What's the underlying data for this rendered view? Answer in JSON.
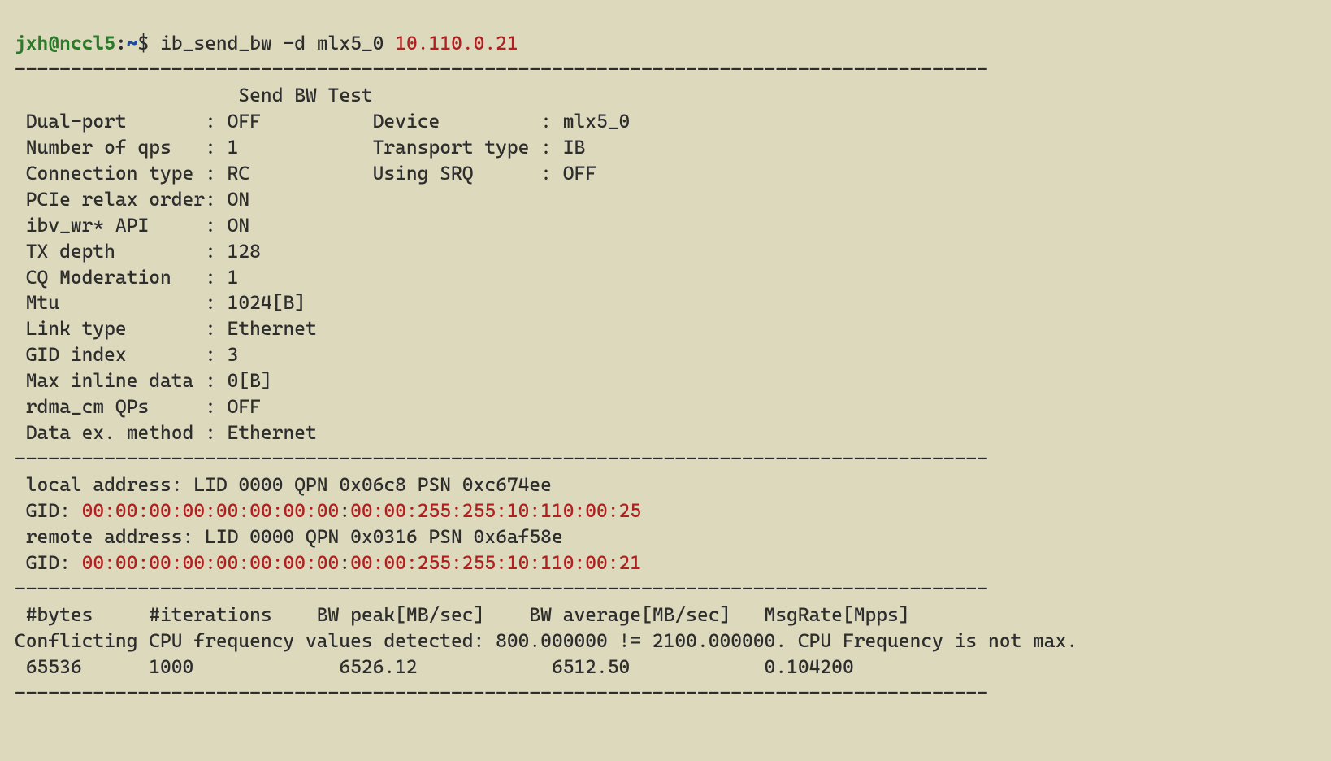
{
  "prompt": {
    "user": "jxh",
    "at": "@",
    "host": "nccl5",
    "colon": ":",
    "path": "~",
    "dollar": "$ ",
    "cmd": "ib_send_bw -d mlx5_0 ",
    "target": "10.110.0.21"
  },
  "dashes": "---------------------------------------------------------------------------------------",
  "title": "                    Send BW Test",
  "props": {
    "l01": " Dual-port       : OFF\t\tDevice         : mlx5_0",
    "l02": " Number of qps   : 1\t\tTransport type : IB",
    "l03": " Connection type : RC\t\tUsing SRQ      : OFF",
    "l04": " PCIe relax order: ON",
    "l05": " ibv_wr* API     : ON",
    "l06": " TX depth        : 128",
    "l07": " CQ Moderation   : 1",
    "l08": " Mtu             : 1024[B]",
    "l09": " Link type       : Ethernet",
    "l10": " GID index       : 3",
    "l11": " Max inline data : 0[B]",
    "l12": " rdma_cm QPs\t : OFF",
    "l13": " Data ex. method : Ethernet"
  },
  "addr": {
    "local": " local address: LID 0000 QPN 0x06c8 PSN 0xc674ee",
    "gid1_label": " GID: ",
    "gid1_a": "00:00:00:00:00:00:00:00",
    "gid1_sep": ":",
    "gid1_b": "00:00:255:255:10:110:00:25",
    "remote": " remote address: LID 0000 QPN 0x0316 PSN 0x6af58e",
    "gid2_label": " GID: ",
    "gid2_a": "00:00:00:00:00:00:00:00",
    "gid2_sep": ":",
    "gid2_b": "00:00:255:255:10:110:00:21"
  },
  "table": {
    "header": " #bytes     #iterations    BW peak[MB/sec]    BW average[MB/sec]   MsgRate[Mpps]",
    "warn": "Conflicting CPU frequency values detected: 800.000000 != 2100.000000. CPU Frequency is not max.",
    "row": " 65536      1000             6526.12            6512.50\t\t   0.104200"
  }
}
